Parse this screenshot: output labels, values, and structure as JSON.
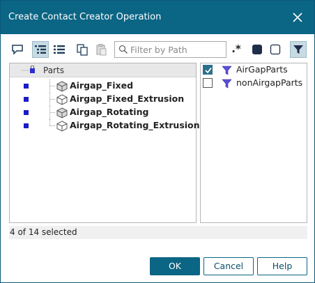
{
  "window": {
    "title": "Create Contact Creator Operation"
  },
  "toolbar": {
    "buttons": [
      {
        "icon": "comment-icon",
        "active": false
      },
      {
        "icon": "tree-view-icon",
        "active": true
      },
      {
        "icon": "list-view-icon",
        "active": false
      },
      {
        "icon": "copy-icon",
        "active": false
      },
      {
        "icon": "paste-icon",
        "active": false,
        "disabled": true
      }
    ],
    "filter": {
      "placeholder": "Filter by Path",
      "value": ""
    },
    "regex_label": ".*"
  },
  "tree": {
    "header": "Parts",
    "items": [
      {
        "name": "Airgap_Fixed",
        "icon": "solid-part-icon"
      },
      {
        "name": "Airgap_Fixed_Extrusion",
        "icon": "wire-part-icon"
      },
      {
        "name": "Airgap_Rotating",
        "icon": "solid-part-icon"
      },
      {
        "name": "Airgap_Rotating_Extrusion",
        "icon": "wire-part-icon"
      }
    ]
  },
  "filters": {
    "items": [
      {
        "name": "AirGapParts",
        "checked": true
      },
      {
        "name": "nonAirgapParts",
        "checked": false
      }
    ]
  },
  "status": "4 of 14 selected",
  "buttons": {
    "ok": "OK",
    "cancel": "Cancel",
    "help": "Help"
  },
  "colors": {
    "titlebar": "#0b6584",
    "accent": "#2a6f8c",
    "selection_square": "#1b1bc8"
  }
}
